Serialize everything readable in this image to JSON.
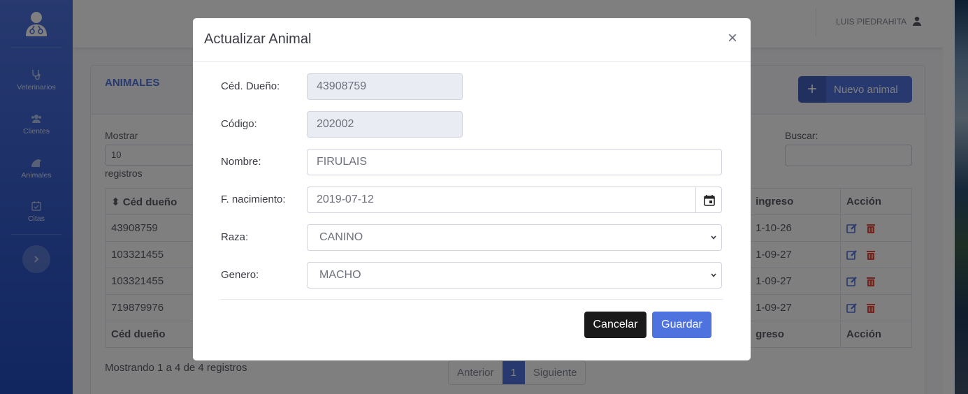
{
  "sidebar": {
    "brand_icon": "doctor-avatar-icon",
    "items": [
      {
        "label": "Veterinarios",
        "icon": "stethoscope-icon"
      },
      {
        "label": "Clientes",
        "icon": "users-icon"
      },
      {
        "label": "Animales",
        "icon": "paw-icon"
      },
      {
        "label": "Citas",
        "icon": "calendar-check-icon"
      }
    ],
    "toggle_icon": "chevron-right-icon"
  },
  "topbar": {
    "user_name": "LUIS PIEDRAHITA",
    "user_icon": "user-icon"
  },
  "card": {
    "title": "ANIMALES",
    "new_button_label": "Nuevo animal",
    "show_label": "Mostrar",
    "length_value": "10",
    "records_label": "registros",
    "search_label": "Buscar:",
    "columns": [
      "Céd dueño",
      "ingreso",
      "Acción"
    ],
    "footer_columns": [
      "Céd dueño",
      "greso",
      "Acción"
    ],
    "rows": [
      {
        "ced": "43908759",
        "ingreso": "1-10-26"
      },
      {
        "ced": "103321455",
        "ingreso": "1-09-27"
      },
      {
        "ced": "103321455",
        "ingreso": "1-09-27"
      },
      {
        "ced": "719879976",
        "ingreso": "1-09-27"
      }
    ],
    "info": "Mostrando 1 a 4 de 4 registros",
    "pager": {
      "prev": "Anterior",
      "current": "1",
      "next": "Siguiente"
    }
  },
  "modal": {
    "title": "Actualizar Animal",
    "close": "×",
    "fields": {
      "ced_label": "Céd. Dueño:",
      "ced_value": "43908759",
      "codigo_label": "Código:",
      "codigo_value": "202002",
      "nombre_label": "Nombre:",
      "nombre_value": "FIRULAIS",
      "fnac_label": "F. nacimiento:",
      "fnac_value": "2019-07-12",
      "raza_label": "Raza:",
      "raza_value": "CANINO",
      "genero_label": "Genero:",
      "genero_value": "MACHO"
    },
    "cancel_label": "Cancelar",
    "save_label": "Guardar"
  },
  "colors": {
    "primary": "#4e73df",
    "danger": "#e74a3b",
    "dark_button": "#1a1a1a"
  }
}
